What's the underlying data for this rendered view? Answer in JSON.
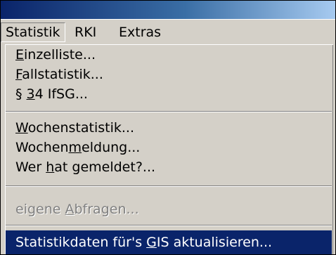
{
  "colors": {
    "title_bar_start": "#0a246a",
    "title_bar_end": "#a6caf0",
    "menu_background": "#d4d0c8",
    "highlight": "#0a246a",
    "highlight_text": "#ffffff",
    "disabled_text": "#808080"
  },
  "menubar": {
    "items": [
      {
        "label": "Statistik",
        "state": "open"
      },
      {
        "label": "RKI",
        "state": "normal"
      },
      {
        "label": "Extras",
        "state": "normal"
      }
    ]
  },
  "statistik_menu": {
    "groups": [
      {
        "items": [
          {
            "pre": "",
            "key": "E",
            "post": "inzelliste...",
            "state": "enabled"
          },
          {
            "pre": "",
            "key": "F",
            "post": "allstatistik...",
            "state": "enabled"
          },
          {
            "pre": "§ ",
            "key": "3",
            "post": "4 IfSG...",
            "state": "enabled"
          }
        ]
      },
      {
        "items": [
          {
            "pre": "",
            "key": "W",
            "post": "ochenstatistik...",
            "state": "enabled"
          },
          {
            "pre": "Wochen",
            "key": "m",
            "post": "eldung...",
            "state": "enabled"
          },
          {
            "pre": "Wer ",
            "key": "h",
            "post": "at gemeldet?...",
            "state": "enabled"
          }
        ]
      },
      {
        "items": [
          {
            "pre": "eigene ",
            "key": "A",
            "post": "bfragen...",
            "state": "disabled"
          }
        ]
      },
      {
        "items": [
          {
            "pre": "Statistikdaten für's ",
            "key": "G",
            "post": "IS aktualisieren...",
            "state": "highlighted"
          }
        ]
      }
    ]
  }
}
